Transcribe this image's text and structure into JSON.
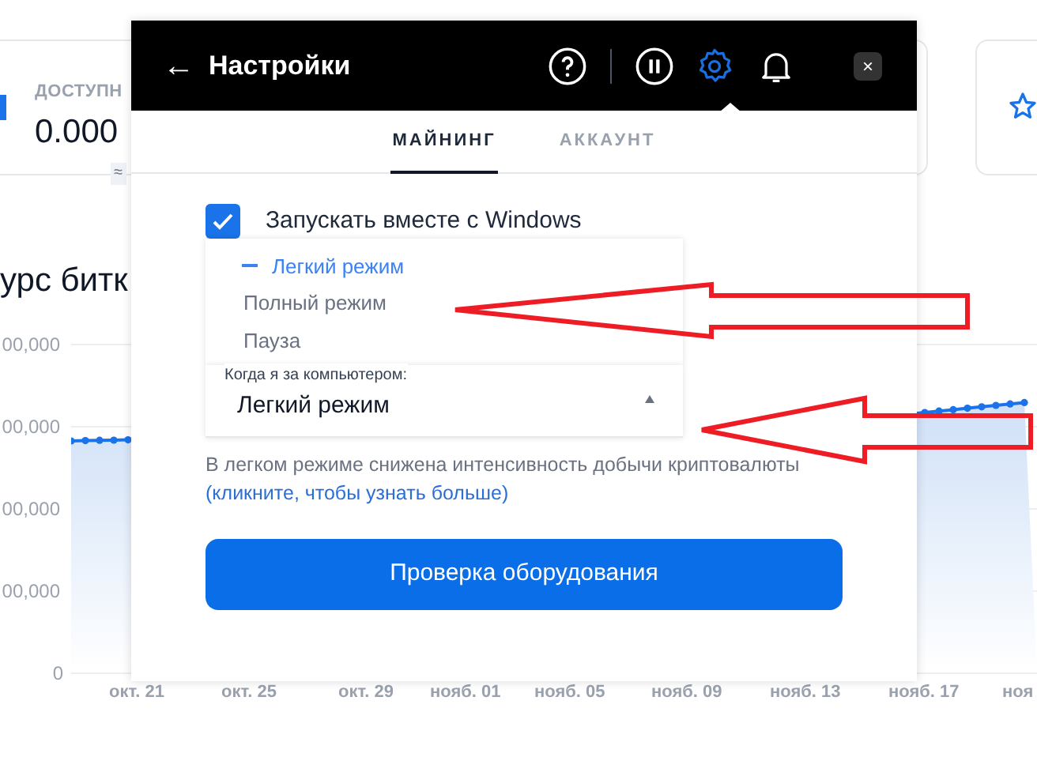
{
  "background": {
    "balance_card": {
      "label": "ДОСТУПН",
      "value": "0.000",
      "badge": "≈"
    },
    "chart": {
      "title": "урс битк",
      "y_labels": [
        "00,000",
        "00,000",
        "00,000",
        "00,000",
        "0"
      ],
      "x_labels": [
        "окт. 21",
        "окт. 25",
        "окт. 29",
        "нояб. 01",
        "нояб. 05",
        "нояб. 09",
        "нояб. 13",
        "нояб. 17",
        "ноя"
      ]
    }
  },
  "dialog": {
    "back": "←",
    "title": "Настройки",
    "header_icons": [
      {
        "kind": "help",
        "selected": false
      },
      {
        "kind": "pause",
        "selected": false
      },
      {
        "kind": "settings",
        "selected": true
      },
      {
        "kind": "bell",
        "selected": false
      }
    ],
    "close": "×",
    "tabs": [
      {
        "label": "МАЙНИНГ",
        "selected": true
      },
      {
        "label": "АККАУНТ",
        "selected": false
      }
    ],
    "autostart": {
      "label": "Запускать вместе с Windows",
      "checked": true
    },
    "mode_select": {
      "label": "Когда я за компьютером:",
      "value": "Легкий режим",
      "expanded": true,
      "options": [
        {
          "label": "Легкий режим",
          "selected": true
        },
        {
          "label": "Полный режим",
          "selected": false
        },
        {
          "label": "Пауза",
          "selected": false
        }
      ]
    },
    "description": "В легком режиме снижена интенсивность добычи криптовалюты",
    "link": "(кликните, чтобы узнать больше)",
    "button": "Проверка оборудования"
  }
}
